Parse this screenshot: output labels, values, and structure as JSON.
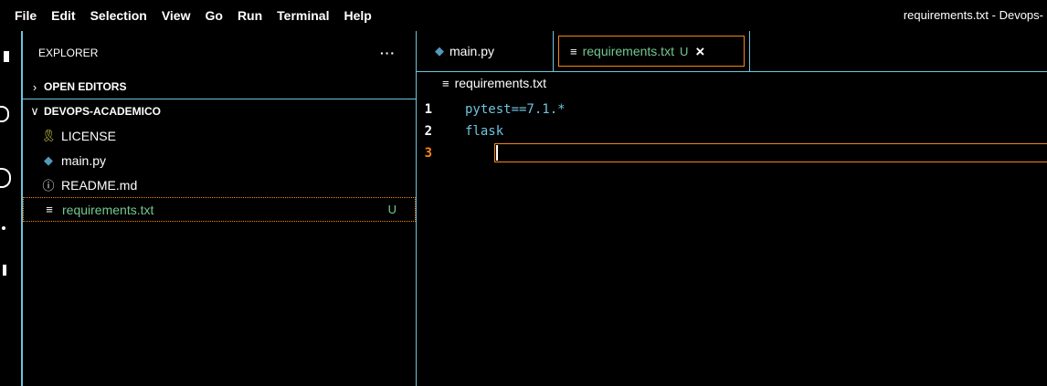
{
  "menubar": {
    "items": [
      "File",
      "Edit",
      "Selection",
      "View",
      "Go",
      "Run",
      "Terminal",
      "Help"
    ],
    "window_title": "requirements.txt - Devops-"
  },
  "sidebar": {
    "header": "EXPLORER",
    "more_actions": "···",
    "open_editors": {
      "label": "OPEN EDITORS",
      "chevron": "›"
    },
    "folder": {
      "label": "DEVOPS-ACADEMICO",
      "chevron": "∨"
    },
    "files": [
      {
        "name": "LICENSE",
        "icon": "license-icon",
        "glyph": "🎗"
      },
      {
        "name": "main.py",
        "icon": "python-icon",
        "glyph": "◆"
      },
      {
        "name": "README.md",
        "icon": "info-icon",
        "glyph": "ⓘ"
      },
      {
        "name": "requirements.txt",
        "icon": "text-file-icon",
        "glyph": "≡",
        "badge": "U"
      }
    ]
  },
  "editor": {
    "tabs": [
      {
        "label": "main.py",
        "icon": "python-icon",
        "glyph": "◆"
      },
      {
        "label": "requirements.txt",
        "icon": "text-file-icon",
        "glyph": "≡",
        "badge": "U",
        "close": "×"
      }
    ],
    "breadcrumb": {
      "label": "requirements.txt",
      "glyph": "≡"
    },
    "lines": [
      {
        "num": "1",
        "text": "pytest==7.1.*"
      },
      {
        "num": "2",
        "text": "flask"
      },
      {
        "num": "3",
        "text": ""
      }
    ]
  },
  "colors": {
    "border": "#6fc3df",
    "focus": "#f38518",
    "untracked": "#73c991",
    "code_text": "#6fc3df"
  }
}
